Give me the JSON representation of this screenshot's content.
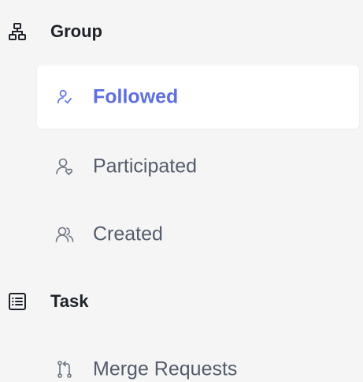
{
  "theme": {
    "accent": "#5e6fe0",
    "text_primary": "#1f2329",
    "text_secondary": "#545c6b",
    "background": "#f5f5f6",
    "active_bg": "#ffffff"
  },
  "nav": {
    "group": {
      "label": "Group",
      "icon": "hierarchy-icon",
      "items": [
        {
          "label": "Followed",
          "icon": "user-check-icon",
          "active": true
        },
        {
          "label": "Participated",
          "icon": "user-heart-icon",
          "active": false
        },
        {
          "label": "Created",
          "icon": "users-icon",
          "active": false
        }
      ]
    },
    "task": {
      "label": "Task",
      "icon": "list-box-icon",
      "items": [
        {
          "label": "Merge Requests",
          "icon": "merge-request-icon",
          "active": false
        }
      ]
    }
  }
}
